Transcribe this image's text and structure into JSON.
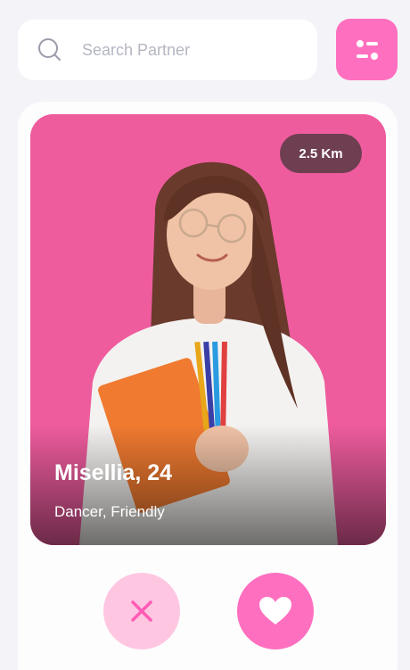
{
  "search": {
    "placeholder": "Search Partner",
    "value": ""
  },
  "filter": {
    "icon": "filter-sliders-icon"
  },
  "profile": {
    "distance": "2.5 Km",
    "name_age": "Misellia, 24",
    "tags": "Dancer, Friendly",
    "photo_icon": "profile-photo"
  },
  "actions": {
    "dislike_icon": "close-icon",
    "like_icon": "heart-icon"
  },
  "colors": {
    "accent": "#ff6fbf",
    "accent_light": "#ffc6e2",
    "background": "#f4f4f8",
    "photo_bg": "#ee5c9e"
  }
}
